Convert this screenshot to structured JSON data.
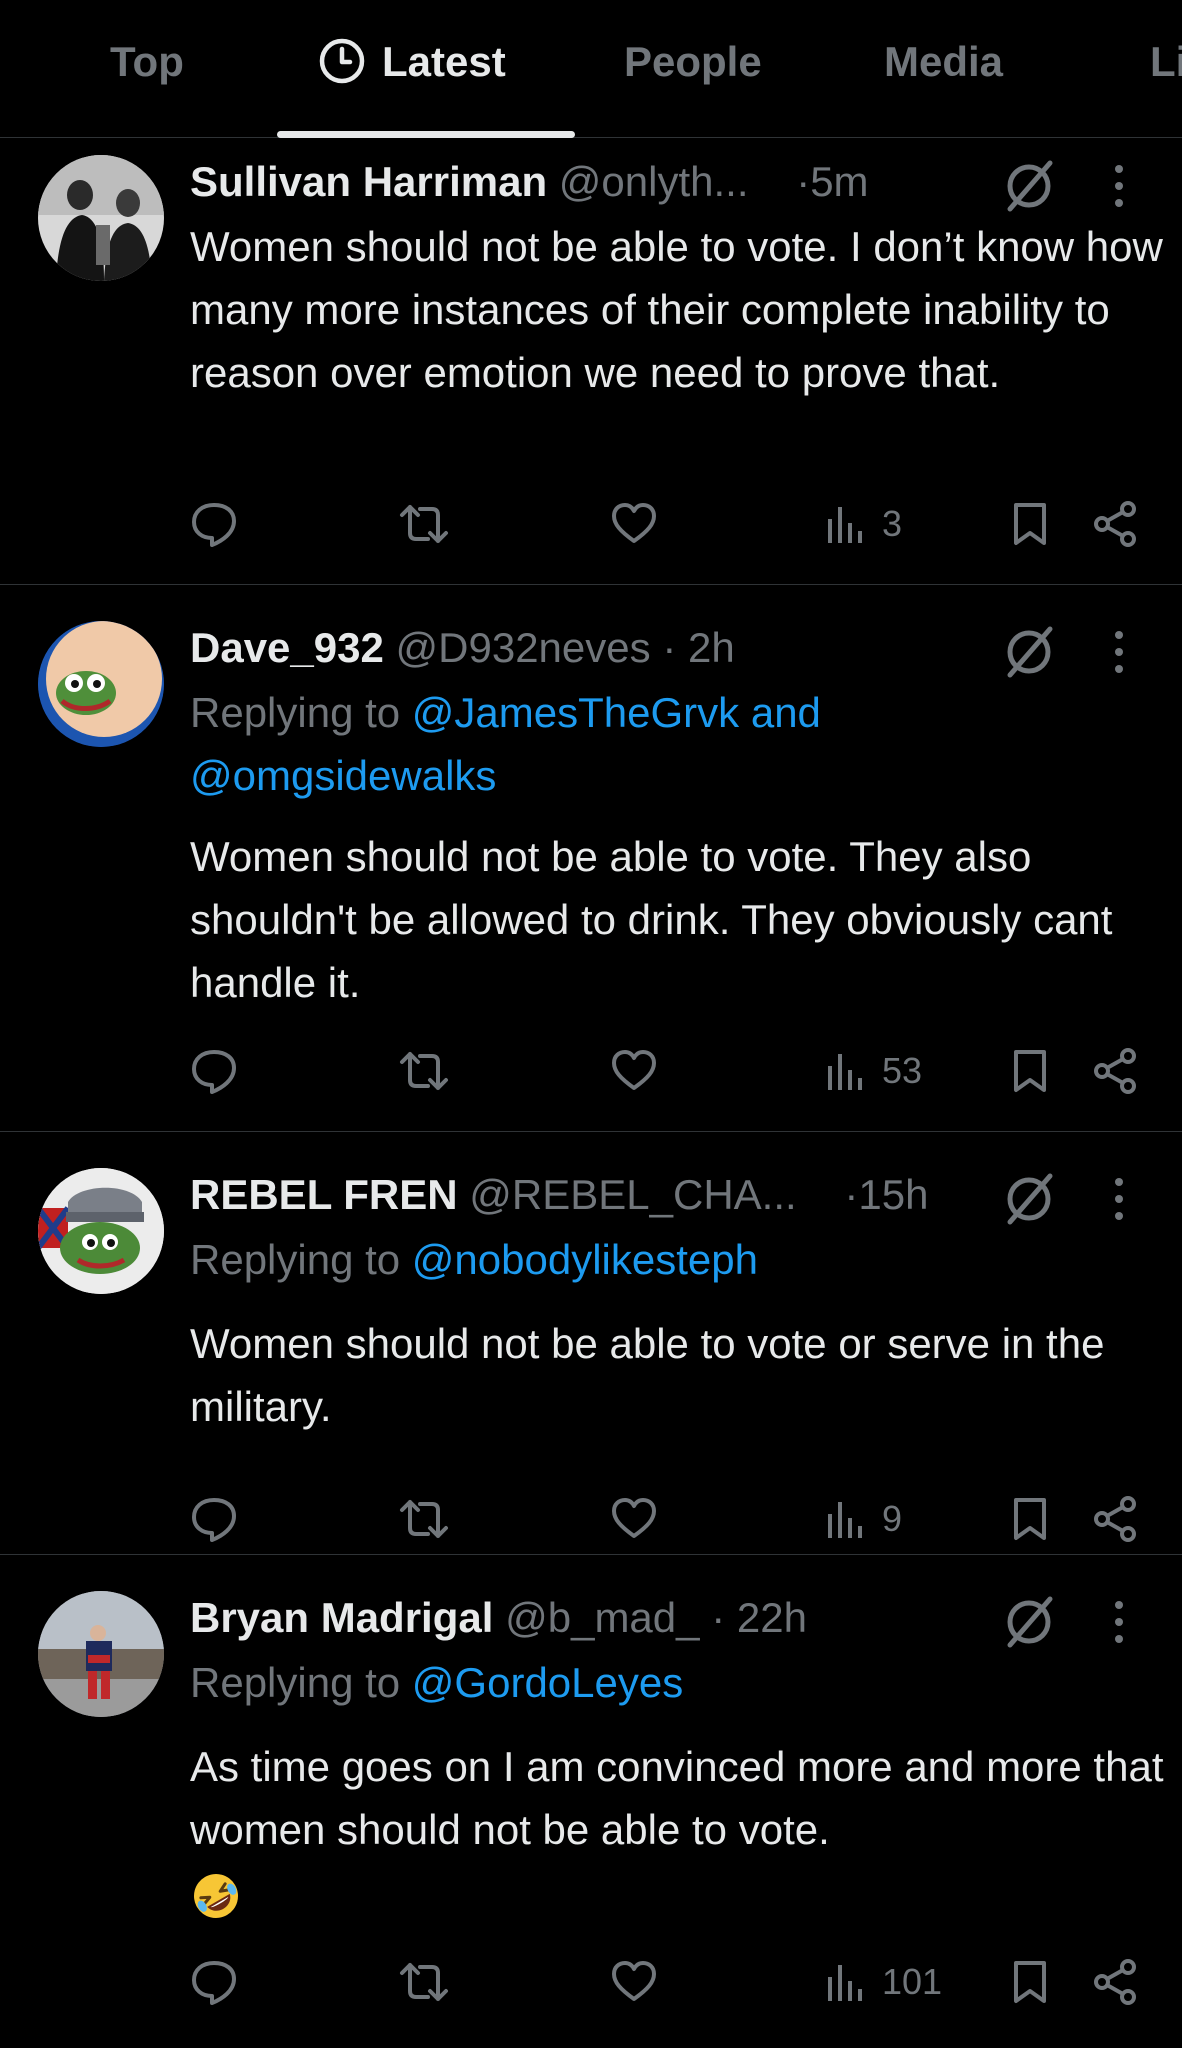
{
  "tabs": [
    {
      "label": "Top"
    },
    {
      "label": "Latest",
      "icon": "clock-icon",
      "active": true
    },
    {
      "label": "People"
    },
    {
      "label": "Media"
    },
    {
      "label": "Li"
    }
  ],
  "tweets": [
    {
      "name": "Sullivan Harriman",
      "handle": "@onlyth...",
      "dot": "·",
      "time": "5m",
      "reply_prefix": "",
      "mentions": [],
      "text": "Women should not be able to vote. I don’t know how many more instances of their complete inability to reason over emotion we need to prove that.",
      "views": "3"
    },
    {
      "name": "Dave_932",
      "handle": "@D932neves",
      "dot": "·",
      "time": "2h",
      "reply_prefix": "Replying to ",
      "mentions": [
        "@JamesTheGrvk and",
        "@omgsidewalks"
      ],
      "text": "Women should not be able to vote. They also shouldn't be allowed to drink. They obviously cant handle it.",
      "views": "53"
    },
    {
      "name": "REBEL FREN",
      "handle": "@REBEL_CHA...",
      "dot": "·",
      "time": "15h",
      "reply_prefix": "Replying to ",
      "mentions": [
        "@nobodylikesteph"
      ],
      "text": "Women should not be able to vote or serve in the military.",
      "views": "9"
    },
    {
      "name": "Bryan Madrigal",
      "handle": "@b_mad_",
      "dot": "·",
      "time": "22h",
      "reply_prefix": "Replying to ",
      "mentions": [
        "@GordoLeyes"
      ],
      "text": "As time goes on I am convinced more and more that women should not be able to vote.",
      "emoji": "rolling-on-floor-laughing-emoji",
      "views": "101"
    }
  ],
  "colors": {
    "background": "#000000",
    "text": "#e7e9ea",
    "muted": "#71767b",
    "link": "#1d9bf0",
    "divider": "#2f3336"
  }
}
